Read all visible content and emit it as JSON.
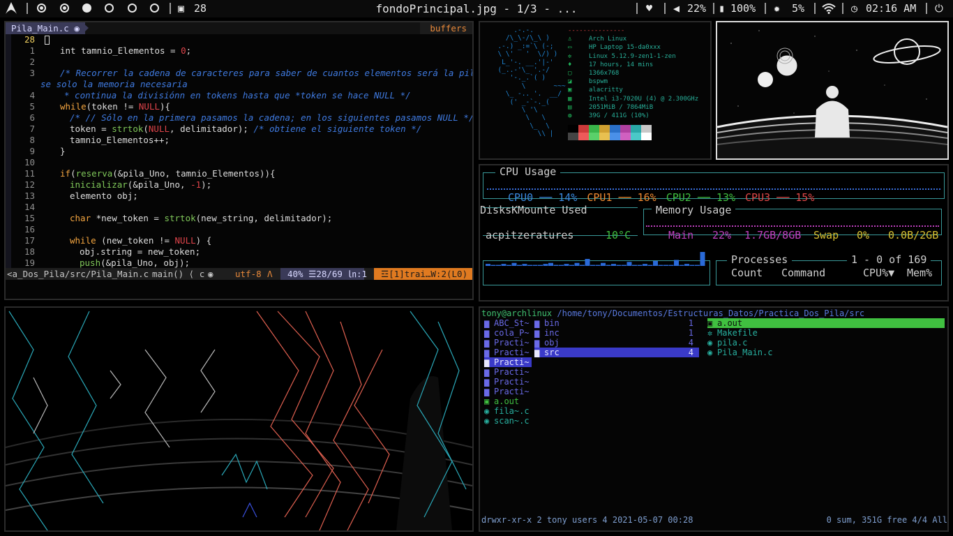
{
  "bar": {
    "title": "fondoPrincipal.jpg - 1/3 - ...",
    "desktop_count": "28",
    "volume": "22%",
    "battery": "100%",
    "brightness": "5%",
    "clock": "02:16 AM"
  },
  "vim": {
    "tab_label": "Pila_Main.c",
    "buffers_label": "buffers",
    "lines": [
      {
        "n": "28",
        "html": ""
      },
      {
        "n": "1",
        "html": "<span style='margin-left:22px'>int tamnio_Elementos = <span class='nl'>0</span>;</span>"
      },
      {
        "n": "2",
        "html": ""
      },
      {
        "n": "3",
        "html": "<span style='margin-left:22px' class='cm'>/* Recorrer la cadena de caracteres para saber de cuantos elementos será la pila, y u</span>"
      },
      {
        "n": "",
        "html": "<span style='margin-left:-6px' class='cm'>se solo la memoria necesaria</span>"
      },
      {
        "n": "4",
        "html": "<span style='margin-left:28px' class='cm'>* continua la divisiónn en tokens hasta que *token se hace NULL */</span>"
      },
      {
        "n": "5",
        "html": "<span style='margin-left:22px'><span class='kw'>while</span>(token != <span class='nl'>NULL</span>){</span>"
      },
      {
        "n": "6",
        "html": "<span style='margin-left:36px' class='cm'>/* // Sólo en la primera pasamos la cadena; en los siguientes pasamos NULL */</span>"
      },
      {
        "n": "7",
        "html": "<span style='margin-left:36px'>token = <span class='fn'>strtok</span>(<span class='nl'>NULL</span>, delimitador); <span class='cm'>/* obtiene el siguiente token */</span></span>"
      },
      {
        "n": "8",
        "html": "<span style='margin-left:36px'>tamnio_Elementos++;</span>"
      },
      {
        "n": "9",
        "html": "<span style='margin-left:22px'>}</span>"
      },
      {
        "n": "10",
        "html": ""
      },
      {
        "n": "11",
        "html": "<span style='margin-left:22px'><span class='kw'>if</span>(<span class='fn'>reserva</span>(&amp;pila_Uno, tamnio_Elementos)){</span>"
      },
      {
        "n": "12",
        "html": "<span style='margin-left:36px'><span class='fn'>inicializar</span>(&amp;pila_Uno, <span class='nl'>-1</span>);</span>"
      },
      {
        "n": "13",
        "html": "<span style='margin-left:36px'>elemento obj;</span>"
      },
      {
        "n": "14",
        "html": ""
      },
      {
        "n": "15",
        "html": "<span style='margin-left:36px'><span class='kw'>char</span> *new_token = <span class='fn'>strtok</span>(new_string, delimitador);</span>"
      },
      {
        "n": "16",
        "html": ""
      },
      {
        "n": "17",
        "html": "<span style='margin-left:36px'><span class='kw'>while</span> (new_token != <span class='nl'>NULL</span>) {</span>"
      },
      {
        "n": "18",
        "html": "<span style='margin-left:50px'>obj.string = new_token;</span>"
      },
      {
        "n": "19",
        "html": "<span style='margin-left:50px'><span class='fn'>push</span>(&amp;pila_Uno, obj);</span>"
      }
    ],
    "status": {
      "path": "<a_Dos_Pila/src/Pila_Main.c",
      "func": "main() ⟨ c",
      "encoding": "utf-8",
      "percent": "40%",
      "pos": "☰28/69",
      "col": "㏑:1",
      "trail": "☲[1]trai…W:2(L0)"
    }
  },
  "neofetch": {
    "dashes": "---------------",
    "info": [
      {
        "icon": "♙",
        "text": "Arch Linux"
      },
      {
        "icon": "▭",
        "text": "HP Laptop 15-da0xxx"
      },
      {
        "icon": "✲",
        "text": "Linux 5.12.9-zen1-1-zen"
      },
      {
        "icon": "♦",
        "text": "17 hours, 14 mins"
      },
      {
        "icon": "▢",
        "text": "1366x768"
      },
      {
        "icon": "◪",
        "text": "bspwm"
      },
      {
        "icon": "▣",
        "text": "alacritty"
      },
      {
        "icon": "▦",
        "text": "Intel i3-7020U (4) @ 2.300GHz"
      },
      {
        "icon": "▤",
        "text": "2051MiB / 7864MiB"
      },
      {
        "icon": "◍",
        "text": "39G / 411G (10%)"
      }
    ],
    "colors_top": [
      "#000000",
      "#cc3a3a",
      "#3ab54a",
      "#d0a030",
      "#2a70c8",
      "#b040a0",
      "#2aa8a8",
      "#c8c8c8"
    ],
    "colors_bottom": [
      "#444444",
      "#ee5a5a",
      "#5ad06a",
      "#e8c050",
      "#4a90e8",
      "#d060c0",
      "#4ac8c8",
      "#ffffff"
    ]
  },
  "bashtop": {
    "cpu_title": "CPU Usage",
    "cpus": [
      {
        "label": "CPU0",
        "value": "14%",
        "color": "#3a8ae0"
      },
      {
        "label": "CPU1",
        "value": "16%",
        "color": "#f08a30"
      },
      {
        "label": "CPU2",
        "value": "13%",
        "color": "#40c040"
      },
      {
        "label": "CPU3",
        "value": "15%",
        "color": "#e04848"
      }
    ],
    "disk_title": "DisksKMounte Used",
    "temp_title": "acpitzeratures",
    "temp_value": "10°C",
    "mem_title": "Memory Usage",
    "main_label": "Main",
    "main_pct": "22%",
    "main_val": "1.7GB/8GB",
    "swap_label": "Swap",
    "swap_pct": "0%",
    "swap_val": "0.0B/2GB",
    "proc_title": "Processes",
    "proc_range": "1 - 0 of 169",
    "col_count": "Count",
    "col_command": "Command",
    "col_cpu": "CPU%▼",
    "col_mem": "Mem%",
    "net_bars": [
      2,
      1,
      1,
      2,
      1,
      3,
      1,
      2,
      1,
      1,
      1,
      2,
      3,
      1,
      1,
      2,
      1,
      3,
      1,
      7,
      1,
      1,
      3,
      1,
      2,
      1,
      1,
      4,
      1,
      1,
      2,
      1,
      5,
      1,
      1,
      1,
      6,
      1,
      2,
      1,
      1,
      14
    ]
  },
  "ranger": {
    "user": "tony@archlinux",
    "path": "/home/tony/Documentos/Estructuras_Datos/Practica_Dos_Pila/src",
    "col1": [
      {
        "icon": "dir",
        "name": "ABC_St~",
        "sel": false
      },
      {
        "icon": "dir",
        "name": "cola_P~",
        "sel": false
      },
      {
        "icon": "dir",
        "name": "Practi~",
        "sel": false
      },
      {
        "icon": "dir",
        "name": "Practi~",
        "sel": false
      },
      {
        "icon": "dir",
        "name": "Practi~",
        "sel": true
      },
      {
        "icon": "dir",
        "name": "Practi~",
        "sel": false
      },
      {
        "icon": "dir",
        "name": "Practi~",
        "sel": false
      },
      {
        "icon": "dir",
        "name": "Practi~",
        "sel": false
      },
      {
        "icon": "exe",
        "name": "a.out",
        "sel": false
      },
      {
        "icon": "c",
        "name": "fila~.c",
        "sel": false
      },
      {
        "icon": "c",
        "name": "scan~.c",
        "sel": false
      }
    ],
    "col2": [
      {
        "icon": "dir",
        "name": "bin",
        "count": "1",
        "sel": false
      },
      {
        "icon": "dir",
        "name": "inc",
        "count": "1",
        "sel": false
      },
      {
        "icon": "dir",
        "name": "obj",
        "count": "4",
        "sel": false
      },
      {
        "icon": "dir",
        "name": "src",
        "count": "4",
        "sel": true
      }
    ],
    "col3": [
      {
        "icon": "exe",
        "name": "a.out",
        "sel": true
      },
      {
        "icon": "mk",
        "name": "Makefile",
        "sel": false
      },
      {
        "icon": "c",
        "name": "pila.c",
        "sel": false
      },
      {
        "icon": "c",
        "name": "Pila_Main.c",
        "sel": false
      }
    ],
    "status_left": "drwxr-xr-x 2 tony users 4 2021-05-07 00:28",
    "status_right": "0 sum, 351G free  4/4  All"
  }
}
